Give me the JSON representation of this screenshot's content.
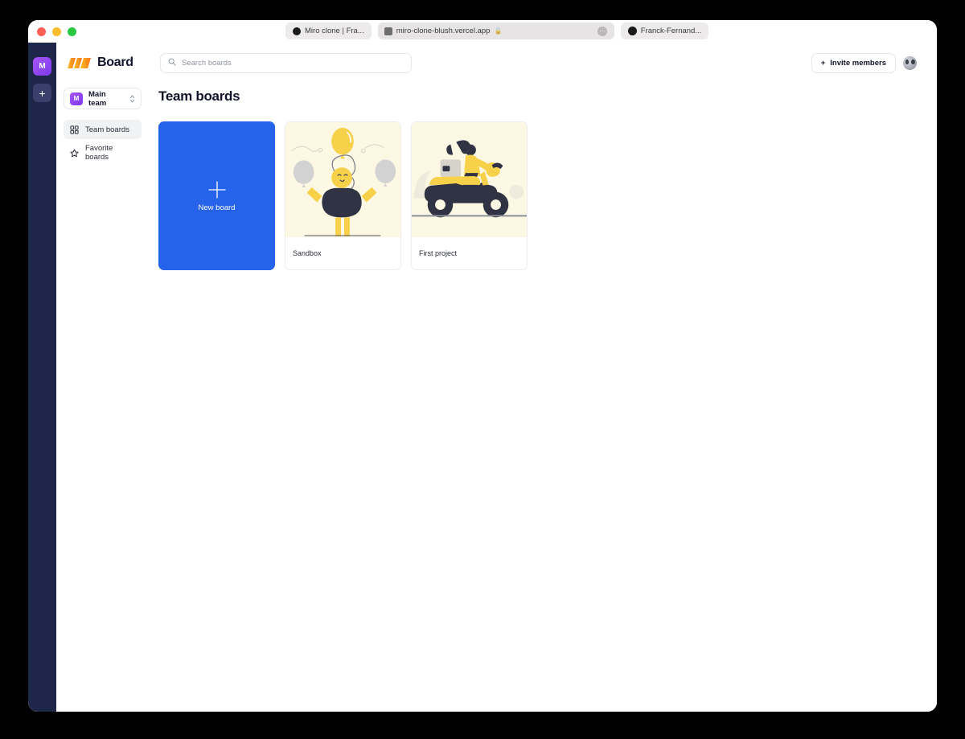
{
  "browser": {
    "tabs": [
      {
        "title": "Miro clone | Fra...",
        "icon": "circle-favicon"
      },
      {
        "title": "miro-clone-blush.vercel.app",
        "icon": "page-favicon",
        "lock": "🔒",
        "menu": "⋯"
      },
      {
        "title": "Franck-Fernand...",
        "icon": "github-icon"
      }
    ]
  },
  "rail": {
    "team_tile_label": "M",
    "add_team_label": "+"
  },
  "sidebar": {
    "brand": "Board",
    "team": {
      "avatar_label": "M",
      "name": "Main team"
    },
    "nav": [
      {
        "label": "Team boards",
        "icon": "grid-icon",
        "active": true
      },
      {
        "label": "Favorite boards",
        "icon": "star-icon",
        "active": false
      }
    ]
  },
  "topbar": {
    "search_placeholder": "Search boards",
    "search_value": "",
    "invite_label": "Invite members",
    "invite_plus": "+"
  },
  "main": {
    "section_title": "Team boards",
    "new_board_label": "New board",
    "boards": [
      {
        "name": "Sandbox",
        "illustration": "balloons-character"
      },
      {
        "name": "First project",
        "illustration": "scooter-rider"
      }
    ]
  },
  "colors": {
    "accent_blue": "#2563eb",
    "rail_navy": "#1e2749",
    "brand_orange": "#f59e0b",
    "thumb_cream": "#fdf8e3",
    "illustration_navy": "#2f3343",
    "illustration_yellow": "#f7d14a"
  }
}
